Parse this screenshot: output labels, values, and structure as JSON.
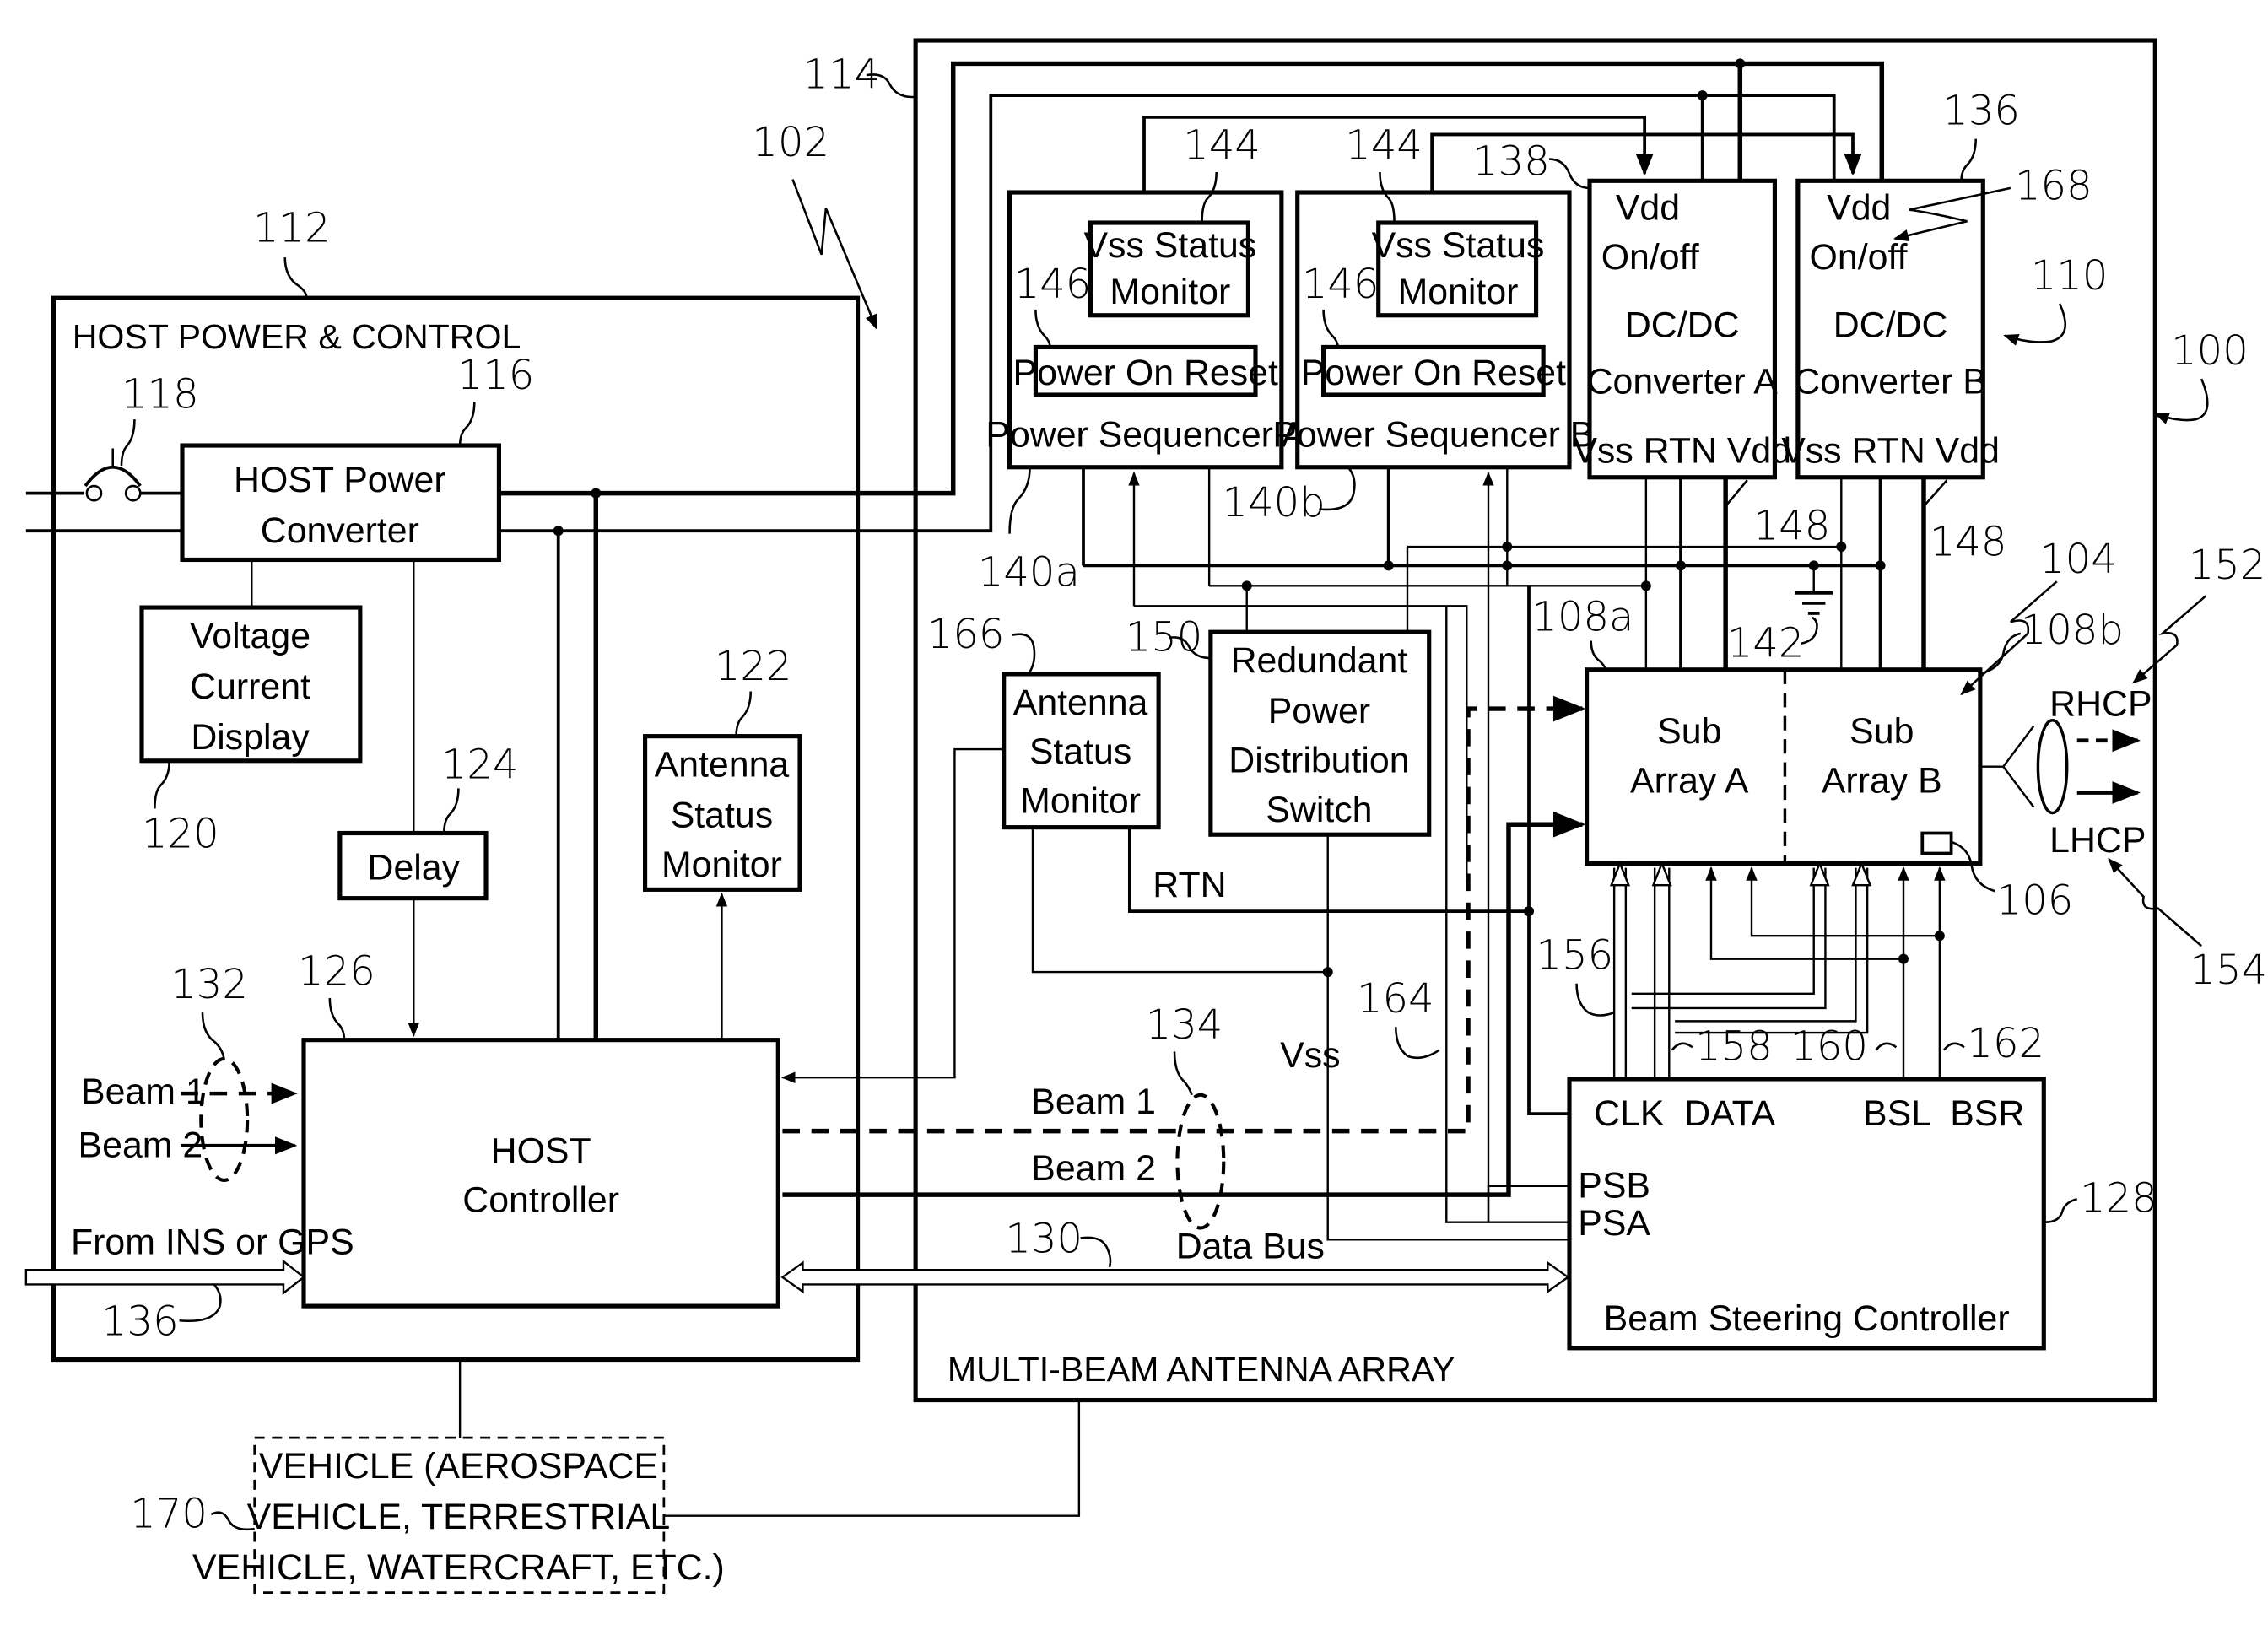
{
  "figure": {
    "title_ref": "100",
    "host_section": {
      "ref": "112",
      "title": "HOST POWER & CONTROL",
      "power_converter": {
        "ref": "116",
        "lines": [
          "HOST Power",
          "Converter"
        ]
      },
      "switch_ref": "118",
      "vi_display": {
        "ref": "120",
        "lines": [
          "Voltage",
          "Current",
          "Display"
        ]
      },
      "antenna_status_monitor": {
        "ref": "122",
        "lines": [
          "Antenna",
          "Status",
          "Monitor"
        ]
      },
      "delay": {
        "ref": "124",
        "label": "Delay"
      },
      "host_controller": {
        "ref": "126",
        "lines": [
          "HOST",
          "Controller"
        ]
      },
      "beam_inputs_ref": "132",
      "beam1": "Beam 1",
      "beam2": "Beam 2",
      "ins_gps": {
        "label": "From INS or GPS",
        "ref": "136"
      }
    },
    "antenna_section": {
      "ref": "114",
      "group_ref": "102",
      "title": "MULTI-BEAM ANTENNA ARRAY",
      "power_seq_a": {
        "ref": "140a",
        "label": "Power Sequencer A",
        "vss_monitor": [
          "Vss Status",
          "Monitor"
        ],
        "vss_ref": "144",
        "por": "Power On Reset",
        "por_ref": "146"
      },
      "power_seq_b": {
        "ref": "140b",
        "label": "Power Sequencer B",
        "vss_monitor": [
          "Vss Status",
          "Monitor"
        ],
        "vss_ref": "144",
        "por": "Power On Reset",
        "por_ref": "146"
      },
      "dcdc_a": {
        "ref": "138",
        "vdd": "Vdd",
        "onoff": "On/off",
        "lines": [
          "DC/DC",
          "Converter A"
        ],
        "pins": "Vss RTN Vdd",
        "pin_ref": "148"
      },
      "dcdc_b": {
        "ref": "136",
        "vdd": "Vdd",
        "onoff": "On/off",
        "onoff_ref": "168",
        "lines": [
          "DC/DC",
          "Converter B"
        ],
        "pins": "Vss RTN Vdd",
        "pin_ref": "148",
        "group_ref": "110"
      },
      "ground_ref": "142",
      "antenna_status_monitor": {
        "ref": "166",
        "lines": [
          "Antenna",
          "Status",
          "Monitor"
        ]
      },
      "rpds": {
        "ref": "150",
        "lines": [
          "Redundant",
          "Power",
          "Distribution",
          "Switch"
        ]
      },
      "rtn_label": "RTN",
      "vss_label": "Vss",
      "subarray_group_ref": "104",
      "sub_a": {
        "ref": "108a",
        "lines": [
          "Sub",
          "Array A"
        ]
      },
      "sub_b": {
        "ref": "108b",
        "lines": [
          "Sub",
          "Array B"
        ]
      },
      "element_ref": "106",
      "rhcp": {
        "label": "RHCP",
        "ref": "152"
      },
      "lhcp": {
        "label": "LHCP",
        "ref": "154"
      },
      "bus_refs": {
        "clk": "156",
        "data": "158",
        "bsl": "160",
        "bsr": "162"
      },
      "beam1_ref": "164",
      "beam_bus_ref": "134",
      "beam1": "Beam 1",
      "beam2": "Beam 2",
      "data_bus": {
        "label": "Data Bus",
        "ref": "130"
      },
      "bsc": {
        "ref": "128",
        "title": "Beam Steering Controller",
        "pins_top_left": "CLK  DATA",
        "pins_top_right": "BSL  BSR",
        "psb": "PSB",
        "psa": "PSA"
      }
    },
    "vehicle": {
      "ref": "170",
      "lines": [
        "VEHICLE (AEROSPACE",
        "VEHICLE, TERRESTRIAL",
        "VEHICLE, WATERCRAFT, ETC.)"
      ]
    }
  }
}
